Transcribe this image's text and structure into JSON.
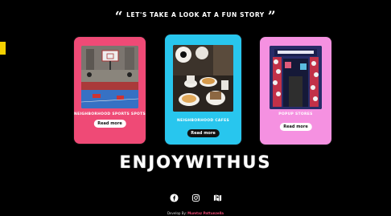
{
  "heading": {
    "text": "LET'S TAKE A LOOK AT A FUN STORY",
    "open_quote": "“",
    "close_quote": "”"
  },
  "cards": [
    {
      "title": "NEIGHBORHOOD SPORTS SPOTS",
      "button": "Read more",
      "color": "#ef4a76",
      "image_icon": "basketball-court-photo"
    },
    {
      "title": "NEIGHBORHOOD CAFES",
      "button": "Read more",
      "color": "#28c6ee",
      "image_icon": "cafe-table-photo"
    },
    {
      "title": "POPUP STORES",
      "button": "Read more",
      "color": "#f591e1",
      "image_icon": "popup-store-photo"
    }
  ],
  "brand": "ENJOYWITHUS",
  "socials": [
    {
      "icon": "facebook-icon"
    },
    {
      "icon": "instagram-icon"
    },
    {
      "icon": "map-icon"
    }
  ],
  "footer": {
    "prefix": "Develop By:",
    "name": "Mumtaz Pattunzella"
  },
  "colors": {
    "background": "#000000",
    "accent_yellow": "#f5d100"
  }
}
